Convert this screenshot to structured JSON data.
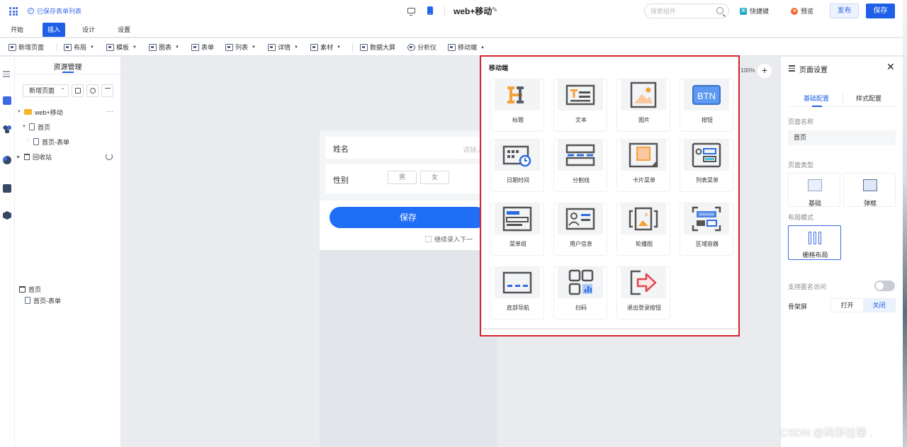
{
  "header": {
    "saved_note": "已保存表单列表",
    "title": "web+移动",
    "search_placeholder": "搜索组件",
    "shortcut_label": "快捷键",
    "preview_label": "预览",
    "publish_label": "发布",
    "save_label": "保存"
  },
  "menu_tabs": [
    "开始",
    "插入",
    "设计",
    "设置"
  ],
  "active_menu_tab": "插入",
  "toolbar": {
    "items": [
      "新增页面",
      "布局",
      "模板",
      "图表",
      "表单",
      "列表",
      "详情",
      "素材",
      "数据大屏",
      "分析仪",
      "移动端"
    ]
  },
  "resources": {
    "title": "资源管理",
    "new_page_button": "新增页面",
    "tree": {
      "root": "web+移动",
      "page": "首页",
      "form": "首页-表单",
      "recycle": "回收站"
    },
    "page_list": {
      "page": "首页",
      "form": "首页-表单"
    }
  },
  "canvas": {
    "zoom": "100%",
    "zoom_in": "+",
    "form": {
      "name_label": "姓名",
      "name_placeholder": "请输入",
      "sex_label": "性别",
      "sex_options": [
        "男",
        "女"
      ],
      "save_button": "保存",
      "continue_label": "继续录入下一"
    }
  },
  "popup": {
    "title": "移动端",
    "components": [
      {
        "label": "标题",
        "icon": "title-icon"
      },
      {
        "label": "文本",
        "icon": "text-icon"
      },
      {
        "label": "图片",
        "icon": "image-icon"
      },
      {
        "label": "按钮",
        "icon": "button-icon",
        "icon_text": "BTN"
      },
      {
        "label": "日期时间",
        "icon": "datetime-icon"
      },
      {
        "label": "分割线",
        "icon": "divider-icon"
      },
      {
        "label": "卡片菜单",
        "icon": "card-menu-icon"
      },
      {
        "label": "列表菜单",
        "icon": "list-menu-icon"
      },
      {
        "label": "菜单组",
        "icon": "menu-group-icon"
      },
      {
        "label": "用户信息",
        "icon": "user-info-icon"
      },
      {
        "label": "轮播图",
        "icon": "carousel-icon"
      },
      {
        "label": "区域容器",
        "icon": "area-container-icon"
      },
      {
        "label": "底部导航",
        "icon": "bottom-nav-icon"
      },
      {
        "label": "扫码",
        "icon": "scan-icon"
      },
      {
        "label": "退出登录按钮",
        "icon": "logout-icon"
      }
    ]
  },
  "settings": {
    "title": "页面设置",
    "close": "✕",
    "tabs": [
      "基础配置",
      "样式配置"
    ],
    "page_name_label": "页面名称",
    "page_name_value": "首页",
    "page_type_label": "页面类型",
    "page_types": [
      "基础",
      "弹框"
    ],
    "layout_label": "布局模式",
    "layout_value": "栅格布局",
    "anonymous_label": "支持匿名访问",
    "anonymous_enabled": false,
    "skeleton_label": "骨架屏",
    "skeleton_options": [
      "打开",
      "关闭"
    ],
    "skeleton_selected": "关闭"
  },
  "colors": {
    "primary": "#1f5fe7",
    "highlight_border": "#d2252d",
    "accent_orange": "#f5a13a"
  },
  "watermark": "CSDN @码莎拉蒂 ."
}
